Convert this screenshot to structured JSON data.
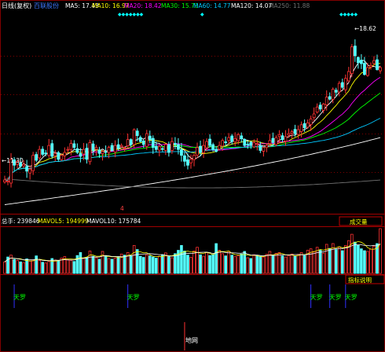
{
  "header": {
    "period_label": "日线(复权)",
    "stock_name": "百联股份",
    "ma": [
      {
        "label": "MA5: 17.43",
        "color": "#ffffff"
      },
      {
        "label": "MA10: 16.97",
        "color": "#ffff00"
      },
      {
        "label": "MA20: 18.42",
        "color": "#ff00ff"
      },
      {
        "label": "MA30: 15.73",
        "color": "#00ff00"
      },
      {
        "label": "MA60: 14.77",
        "color": "#00c8ff"
      },
      {
        "label": "MA120: 14.07",
        "color": "#ffffff"
      },
      {
        "label": "MA250: 11.88",
        "color": "#707070"
      }
    ]
  },
  "price_panel": {
    "high_label": "18.62",
    "low_label": "11.30",
    "marker_label": "4"
  },
  "volume_panel": {
    "header": [
      {
        "label": "总手: 239846",
        "color": "#ffffff"
      },
      {
        "label": "MAVOL5: 194999",
        "color": "#ffff00"
      },
      {
        "label": "MAVOL10: 175784",
        "color": "#ffffff"
      }
    ],
    "button_label": "成交量"
  },
  "indicator_panel": {
    "button_label": "指标说明",
    "signals": [
      "天罗",
      "天罗",
      "天罗",
      "天罗",
      "天罗"
    ],
    "bottom_label": "地网"
  },
  "colors": {
    "up": "#ff3232",
    "down": "#54ffff",
    "grid": "#800000",
    "signal_line": "#3030ff"
  },
  "chart_data": {
    "type": "candlestick",
    "x_range": [
      0,
      120
    ],
    "price_range": [
      10.0,
      19.8
    ],
    "close": [
      11.55,
      11.5,
      12.6,
      12.3,
      12.5,
      12.25,
      12.35,
      12.0,
      12.1,
      12.8,
      12.55,
      13.1,
      12.85,
      12.9,
      13.3,
      12.75,
      12.9,
      12.6,
      12.8,
      12.95,
      13.1,
      13.4,
      13.2,
      12.95,
      12.75,
      13.1,
      12.6,
      13.45,
      13.05,
      13.2,
      12.9,
      13.0,
      12.95,
      13.2,
      13.05,
      13.3,
      13.15,
      13.3,
      13.2,
      13.6,
      13.35,
      14.1,
      13.8,
      13.5,
      13.35,
      13.9,
      13.6,
      13.2,
      13.1,
      13.25,
      13.1,
      13.35,
      12.95,
      13.5,
      13.35,
      13.1,
      12.8,
      12.5,
      12.3,
      12.6,
      12.8,
      13.2,
      12.95,
      13.3,
      13.5,
      13.3,
      13.1,
      13.0,
      13.3,
      13.55,
      13.45,
      13.7,
      13.5,
      13.65,
      13.85,
      13.65,
      13.3,
      13.35,
      13.3,
      13.45,
      13.4,
      13.05,
      13.2,
      13.3,
      13.55,
      13.45,
      13.7,
      13.85,
      13.6,
      13.75,
      13.9,
      14.0,
      13.9,
      14.1,
      14.35,
      14.2,
      14.45,
      14.65,
      14.9,
      15.25,
      15.15,
      15.4,
      15.75,
      15.65,
      16.15,
      16.0,
      16.45,
      16.25,
      16.7,
      17.05,
      18.3,
      17.85,
      17.5,
      17.45,
      16.9,
      17.25,
      17.35,
      17.6,
      17.15,
      17.25
    ],
    "high_marker_value": 18.62,
    "low_marker_value": 11.3,
    "volume_range": [
      0,
      240000
    ],
    "volume": [
      62000,
      88000,
      98000,
      75000,
      70000,
      62000,
      58000,
      78000,
      66000,
      72000,
      94000,
      70000,
      60000,
      56000,
      64000,
      80000,
      72000,
      68000,
      82000,
      90000,
      76000,
      70000,
      64000,
      96000,
      112000,
      80000,
      86000,
      120000,
      92000,
      84000,
      76000,
      118000,
      94000,
      80000,
      76000,
      82000,
      88000,
      104000,
      98000,
      112000,
      96000,
      150000,
      128000,
      92000,
      86000,
      100000,
      94000,
      88000,
      82000,
      92000,
      100000,
      110000,
      90000,
      84000,
      106000,
      124000,
      150000,
      120000,
      98000,
      86000,
      120000,
      140000,
      100000,
      92000,
      112000,
      96000,
      102000,
      160000,
      124000,
      106000,
      94000,
      118000,
      98000,
      90000,
      96000,
      104000,
      118000,
      84000,
      80000,
      100000,
      96000,
      92000,
      88000,
      102000,
      118000,
      96000,
      108000,
      112000,
      94000,
      88000,
      96000,
      104000,
      92000,
      102000,
      112000,
      96000,
      124000,
      132000,
      118000,
      140000,
      126000,
      108000,
      156000,
      134000,
      160000,
      128000,
      142000,
      122000,
      150000,
      176000,
      210000,
      168000,
      150000,
      132000,
      122000,
      118000,
      130000,
      146000,
      160000,
      239846
    ],
    "signals_at_x": [
      3,
      39,
      97,
      103,
      108
    ],
    "bottom_signal_x": 57
  }
}
